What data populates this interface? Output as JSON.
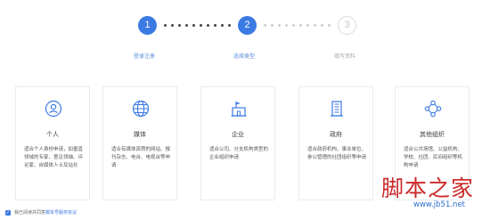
{
  "stepper": {
    "steps": [
      {
        "number": "1",
        "label": "登录注册",
        "state": "completed"
      },
      {
        "number": "2",
        "label": "选择类型",
        "state": "active"
      },
      {
        "number": "3",
        "label": "填写资料",
        "state": "pending"
      }
    ],
    "colors": {
      "active": "#3b79e3",
      "pending": "#c9c9c9"
    }
  },
  "cards": [
    {
      "title": "个人",
      "icon": "person-icon",
      "description": "适合个人身份申请，如垂直领域的专家、意见领袖、评论家、自媒体人士及站长"
    },
    {
      "title": "媒体",
      "icon": "globe-icon",
      "description": "适合有媒体资质的网站、报刊杂志、电台、电视台等申请"
    },
    {
      "title": "企业",
      "icon": "building-flag-icon",
      "description": "适合公司、分支机构类型的企业组织申请"
    },
    {
      "title": "政府",
      "icon": "office-building-icon",
      "description": "适合政府机构、事业单位、参公管理的社团组织等申请"
    },
    {
      "title": "其他组织",
      "icon": "network-icon",
      "description": "适合公共场馆、公益机构、学校、社团、民间组织等机构申请"
    }
  ],
  "agreement": {
    "prefix": "我已阅读并同意",
    "link": "脚本号服务协议",
    "checked": true
  },
  "watermark": {
    "logo": "脚本之家",
    "url": "www.jb51.net"
  }
}
